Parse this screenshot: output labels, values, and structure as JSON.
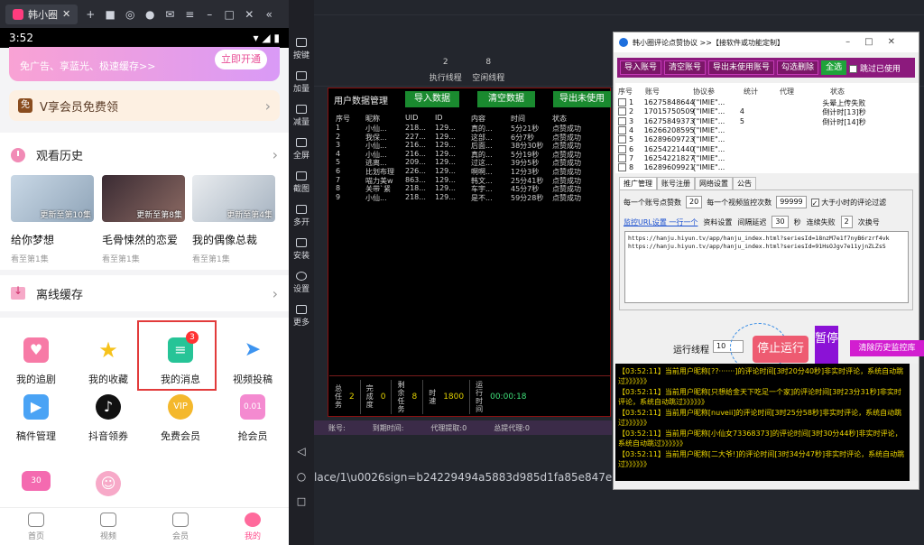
{
  "emulator": {
    "tab_title": "韩小圈",
    "time": "3:52",
    "sidebar": [
      "按键",
      "加量",
      "减量",
      "全屏",
      "截图",
      "多开",
      "安装",
      "设置",
      "更多"
    ]
  },
  "phone": {
    "banner_text": "免广告、享蓝光、极速缓存>>",
    "banner_button": "立即开通",
    "vip_badge": "免",
    "vip_text": "V享会员免费领",
    "history_title": "观看历史",
    "history": [
      {
        "thumb_caption": "更新至第10集",
        "title": "给你梦想",
        "sub": "看至第1集"
      },
      {
        "thumb_caption": "更新至第8集",
        "title": "毛骨悚然的恋爱",
        "sub": "看至第1集"
      },
      {
        "thumb_caption": "更新至第4集",
        "title": "我的偶像总裁",
        "sub": "看至第1集"
      }
    ],
    "offline_title": "离线缓存",
    "grid": [
      {
        "label": "我的追剧",
        "icon": "tv-heart-icon",
        "color": "#f77aa6"
      },
      {
        "label": "我的收藏",
        "icon": "star-icon",
        "color": "#f6c21b"
      },
      {
        "label": "我的消息",
        "icon": "message-icon",
        "color": "#26c497",
        "badge": "3"
      },
      {
        "label": "视频投稿",
        "icon": "paper-plane-icon",
        "color": "#3d94f0"
      },
      {
        "label": "稿件管理",
        "icon": "video-file-icon",
        "color": "#4aa3f5"
      },
      {
        "label": "抖音领券",
        "icon": "tiktok-icon",
        "color": "#111111"
      },
      {
        "label": "免费会员",
        "icon": "vip-crown-icon",
        "color": "#f4b82c"
      },
      {
        "label": "抢会员",
        "icon": "gift-icon",
        "color": "#f48ad0",
        "badge_text": "0.01"
      },
      {
        "label": "",
        "icon": "coupon-icon",
        "color": "#f46ab0",
        "badge_text": "30"
      },
      {
        "label": "",
        "icon": "mascot-icon",
        "color": "#f7a9c8"
      }
    ],
    "nav": [
      {
        "label": "首页"
      },
      {
        "label": "视频"
      },
      {
        "label": "会员"
      },
      {
        "label": "我的"
      }
    ]
  },
  "background": {
    "threads": {
      "exec_count": "2",
      "idle_count": "8",
      "exec_label": "执行线程",
      "idle_label": "空闲线程"
    },
    "url": "lace/1\\u0026sign=b24229494a5883d985d1fa85e847ef54\\u0026",
    "strip": [
      "账号:",
      "到期时间:",
      "代理提取:0",
      "总提代理:0"
    ]
  },
  "user_window": {
    "title": "用户数据管理",
    "import": "导入数据",
    "clear": "清空数据",
    "export": "导出未使用",
    "columns": [
      "序号",
      "昵称",
      "UID",
      "ID",
      "内容",
      "时间",
      "状态"
    ],
    "rows": [
      [
        "1",
        "小仙...",
        "218...",
        "129...",
        "真的...",
        "5分21秒",
        "点赞成功"
      ],
      [
        "2",
        "我保...",
        "227...",
        "129...",
        "这部...",
        "6分7秒",
        "点赞成功"
      ],
      [
        "3",
        "小仙...",
        "216...",
        "129...",
        "后面...",
        "38分30秒",
        "点赞成功"
      ],
      [
        "4",
        "小仙...",
        "216...",
        "129...",
        "真的...",
        "5分19秒",
        "点赞成功"
      ],
      [
        "5",
        "逃离...",
        "209...",
        "129...",
        "过这...",
        "39分5秒",
        "点赞成功"
      ],
      [
        "6",
        "比划布理",
        "226...",
        "129...",
        "啊啊...",
        "12分3秒",
        "点赞成功"
      ],
      [
        "7",
        "喵力美w",
        "863...",
        "129...",
        "韩文...",
        "25分41秒",
        "点赞成功"
      ],
      [
        "8",
        "关带`紧",
        "218...",
        "129...",
        "车宇...",
        "45分7秒",
        "点赞成功"
      ],
      [
        "9",
        "小仙...",
        "218...",
        "129...",
        "是不...",
        "59分28秒",
        "点赞成功"
      ]
    ],
    "stats": {
      "total_label": "总任务",
      "total": "2",
      "done_label": "完成度",
      "done": "0",
      "remain_label": "剩余任务",
      "remain": "8",
      "speed_label": "时速",
      "speed": "1800",
      "runtime_label": "运行时间",
      "runtime": "00:00:18"
    }
  },
  "tool": {
    "title": "韩小圈评论点赞协议 >>【接软件或功能定制】",
    "toolbar": [
      "导入账号",
      "清空账号",
      "导出未使用账号",
      "勾选删除",
      "全选"
    ],
    "skip_used": "跳过已使用",
    "columns": [
      "序号",
      "账号",
      "协议参",
      "统计",
      "代理",
      "状态"
    ],
    "accounts": [
      [
        "1",
        "16275848644",
        "{\"IMIE\"...",
        "",
        "",
        "头晕上传失败"
      ],
      [
        "2",
        "17015750509",
        "{\"IMIE\"...",
        "4",
        "",
        "倒计时[13]秒"
      ],
      [
        "3",
        "16275849373",
        "{\"IMIE\"...",
        "5",
        "",
        "倒计时[14]秒"
      ],
      [
        "4",
        "16266208595",
        "{\"IMIE\"...",
        "",
        "",
        ""
      ],
      [
        "5",
        "16289609723",
        "{\"IMIE\"...",
        "",
        "",
        ""
      ],
      [
        "6",
        "16254221440",
        "{\"IMIE\"...",
        "",
        "",
        ""
      ],
      [
        "7",
        "16254221827",
        "{\"IMIE\"...",
        "",
        "",
        ""
      ],
      [
        "8",
        "16289609921",
        "{\"IMIE\"...",
        "",
        "",
        ""
      ]
    ],
    "tabs": [
      "推广管理",
      "账号注册",
      "网络设置",
      "公告"
    ],
    "likes_label": "每一个账号点赞数",
    "likes": "20",
    "monitor_label": "每一个视频监控次数",
    "monitor": "99999",
    "over_label": "大于小时的评论过滤",
    "subtabs": [
      "监控URL设置 一行一个",
      "资料设置"
    ],
    "interval_label": "间隔延迟",
    "interval": "30",
    "sec": "秒",
    "fail_label": "连续失败",
    "fail": "2",
    "switch": "次换号",
    "urls": [
      "https://hanju.hiyun.tv/app/hanju_index.html?seriesId=18nzM7e1f7nyB6rzrf4vk",
      "https://hanju.hiyun.tv/app/hanju_index.html?seriesId=91HsOJgv7e11yjnZLZsS"
    ],
    "run_label": "运行线程",
    "run_threads": "10",
    "stop": "停止运行",
    "pause": "暂停",
    "clear_history": "清除历史监控库",
    "logs": [
      "【03:52:11】当前用户昵称[??·······]的评论时间[3时20分40秒]非实时评论，系统自动跳过》》》》》》",
      "【03:52:11】当前用户昵称[只想给金天下吃足一个家]的评论时间[3时23分31秒]非实时评论，系统自动跳过》》》》》》",
      "【03:52:11】当前用户昵称[nuveii]的评论时间[3时25分58秒]非实时评论，系统自动跳过》》》》》》",
      "【03:52:11】当前用户昵称[小仙女73368373]的评论时间[3时30分44秒]非实时评论，系统自动跳过》》》》》》",
      "【03:52:11】当前用户昵称[二大爷!]的评论时间[3时34分47秒]非实时评论，系统自动跳过》》》》》》"
    ]
  }
}
